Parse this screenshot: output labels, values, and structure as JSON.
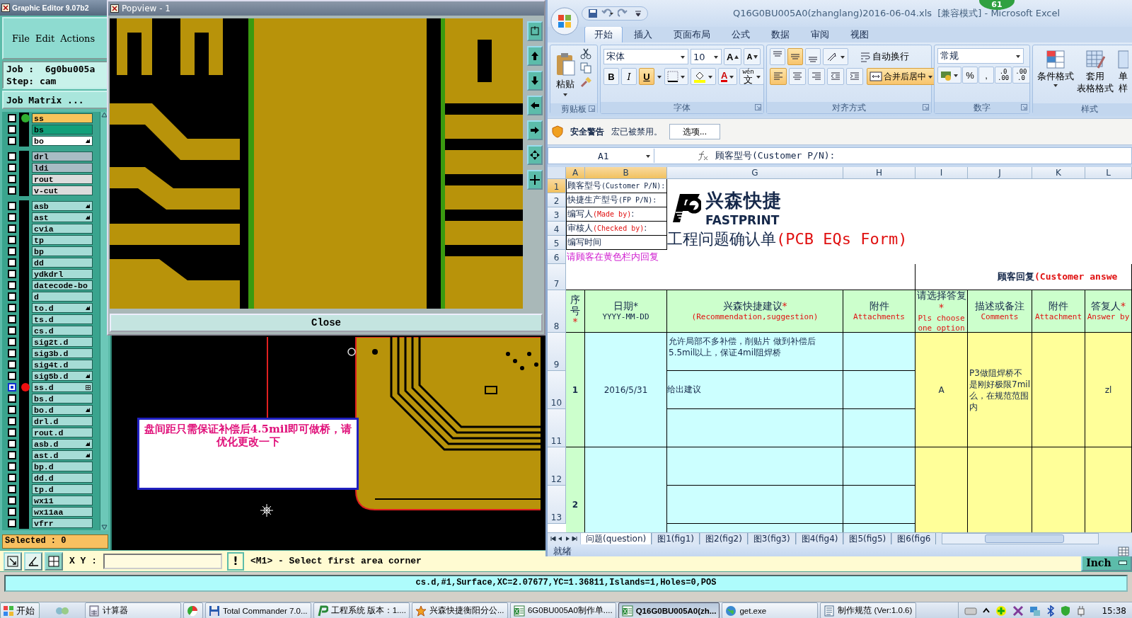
{
  "cam": {
    "title": "Graphic Editor 9.07b2",
    "menu": [
      "File",
      "Edit",
      "Actions"
    ],
    "job": "Job :  6g0bu005a",
    "step": "Step: cam",
    "matrix_button": "Job Matrix ...",
    "layer_groups": [
      {
        "layers": [
          {
            "name": "ss",
            "color": "#f8c45a",
            "dot": {
              "color": "#30b030"
            },
            "kind": "plain",
            "selected": false
          },
          {
            "name": "bs",
            "color": "#12a07a",
            "kind": "plain",
            "selected": false
          },
          {
            "name": "bo",
            "color": "#ffffff",
            "kind": "linked",
            "selected": false
          }
        ]
      },
      {
        "layers": [
          {
            "name": "drl",
            "color": "#a8bcc4",
            "kind": "plain",
            "selected": false
          },
          {
            "name": "ldi",
            "color": "#a8bcc4",
            "kind": "plain",
            "selected": false
          },
          {
            "name": "rout",
            "color": "#dcdcdc",
            "kind": "plain",
            "selected": false
          },
          {
            "name": "v-cut",
            "color": "#dcdcdc",
            "kind": "plain",
            "selected": false
          }
        ]
      },
      {
        "layers": [
          {
            "name": "asb",
            "color": "#a6dcd6",
            "kind": "linked",
            "selected": false
          },
          {
            "name": "ast",
            "color": "#a6dcd6",
            "kind": "linked",
            "selected": false
          },
          {
            "name": "cvia",
            "color": "#a6dcd6",
            "kind": "plain",
            "selected": false
          },
          {
            "name": "tp",
            "color": "#a6dcd6",
            "kind": "plain",
            "selected": false
          },
          {
            "name": "bp",
            "color": "#a6dcd6",
            "kind": "plain",
            "selected": false
          },
          {
            "name": "dd",
            "color": "#a6dcd6",
            "kind": "plain",
            "selected": false
          },
          {
            "name": "ydkdrl",
            "color": "#a6dcd6",
            "kind": "plain",
            "selected": false
          },
          {
            "name": "datecode-bo",
            "color": "#a6dcd6",
            "kind": "plain",
            "selected": false
          },
          {
            "name": "d",
            "color": "#a6dcd6",
            "kind": "plain",
            "selected": false
          },
          {
            "name": "to.d",
            "color": "#a6dcd6",
            "kind": "linked",
            "selected": false
          },
          {
            "name": "ts.d",
            "color": "#a6dcd6",
            "kind": "plain",
            "selected": false
          },
          {
            "name": "cs.d",
            "color": "#a6dcd6",
            "kind": "plain",
            "selected": false
          },
          {
            "name": "sig2t.d",
            "color": "#a6dcd6",
            "kind": "plain",
            "selected": false
          },
          {
            "name": "sig3b.d",
            "color": "#a6dcd6",
            "kind": "plain",
            "selected": false
          },
          {
            "name": "sig4t.d",
            "color": "#a6dcd6",
            "kind": "plain",
            "selected": false
          },
          {
            "name": "sig5b.d",
            "color": "#a6dcd6",
            "kind": "linked",
            "selected": false
          },
          {
            "name": "ss.d",
            "color": "#a6dcd6",
            "dot": {
              "color": "#ee1010"
            },
            "kind": "boxed",
            "selected": true
          },
          {
            "name": "bs.d",
            "color": "#a6dcd6",
            "kind": "plain",
            "selected": false
          },
          {
            "name": "bo.d",
            "color": "#a6dcd6",
            "kind": "linked",
            "selected": false
          },
          {
            "name": "drl.d",
            "color": "#a6dcd6",
            "kind": "plain",
            "selected": false
          },
          {
            "name": "rout.d",
            "color": "#a6dcd6",
            "kind": "plain",
            "selected": false
          },
          {
            "name": "asb.d",
            "color": "#a6dcd6",
            "kind": "linked",
            "selected": false
          },
          {
            "name": "ast.d",
            "color": "#a6dcd6",
            "kind": "linked",
            "selected": false
          },
          {
            "name": "bp.d",
            "color": "#a6dcd6",
            "kind": "plain",
            "selected": false
          },
          {
            "name": "dd.d",
            "color": "#a6dcd6",
            "kind": "plain",
            "selected": false
          },
          {
            "name": "tp.d",
            "color": "#a6dcd6",
            "kind": "plain",
            "selected": false
          },
          {
            "name": "wx11",
            "color": "#a6dcd6",
            "kind": "plain",
            "selected": false
          },
          {
            "name": "wx11aa",
            "color": "#a6dcd6",
            "kind": "plain",
            "selected": false
          },
          {
            "name": "vfrr",
            "color": "#a6dcd6",
            "kind": "plain",
            "selected": false
          }
        ]
      }
    ],
    "selected_count": "Selected : 0",
    "annotation": "盘间距只需保证补偿后4.5mil即可做桥，请优化更改一下",
    "command_bar": {
      "xy_label": "X Y :",
      "alert": "!",
      "message": "<M1> - Select first area corner",
      "unit": "Inch"
    },
    "status_line": "cs.d,#1,Surface,XC=2.07677,YC=1.36811,Islands=1,Holes=0,POS"
  },
  "popview": {
    "title": "Popview - 1",
    "close": "Close"
  },
  "excel": {
    "title": "Q16G0BU005A0(zhanglang)2016-06-04.xls  [兼容模式] - Microsoft Excel",
    "badge": "61",
    "tabs": [
      {
        "label": "开始",
        "selected": true
      },
      {
        "label": "插入",
        "selected": false
      },
      {
        "label": "页面布局",
        "selected": false
      },
      {
        "label": "公式",
        "selected": false
      },
      {
        "label": "数据",
        "selected": false
      },
      {
        "label": "审阅",
        "selected": false
      },
      {
        "label": "视图",
        "selected": false
      }
    ],
    "clipboard": {
      "paste": "粘贴",
      "label": "剪贴板"
    },
    "font": {
      "name": "宋体",
      "size": "10",
      "grow": "A",
      "shrink": "A",
      "styles": [
        {
          "label": "B",
          "on": false
        },
        {
          "label": "I",
          "on": false
        },
        {
          "label": "U",
          "on": true
        }
      ],
      "color_letter": "A",
      "phonetic": {
        "ruby": "wén",
        "label": "文"
      },
      "label": "字体"
    },
    "alignment": {
      "vertical": [
        {
          "on": false
        },
        {
          "on": true
        },
        {
          "on": false
        }
      ],
      "wrap": "自动换行",
      "horizontal": [
        {
          "on": true
        },
        {
          "on": false
        },
        {
          "on": false
        }
      ],
      "merge": {
        "label": "合并后居中",
        "on": true
      },
      "label": "对齐方式"
    },
    "number": {
      "format": "常规",
      "percent": "%",
      "comma": ",",
      "increase_decimal": [
        ".0",
        ".00"
      ],
      "decrease_decimal": [
        ".00",
        ".0"
      ],
      "label": "数字"
    },
    "styles": {
      "conditional": "条件格式",
      "table": [
        "套用",
        "表格格式"
      ],
      "cell": [
        "单",
        "样"
      ],
      "label": "样式"
    },
    "security": {
      "title": "安全警告",
      "message": "宏已被禁用。",
      "button": "选项..."
    },
    "name_box": "A1",
    "formula": "顾客型号(Customer P/N):",
    "columns": [
      {
        "label": "A",
        "selected": true
      },
      {
        "label": "B",
        "selected": true
      },
      {
        "label": "G",
        "selected": false
      },
      {
        "label": "H",
        "selected": false
      },
      {
        "label": "I",
        "selected": false
      },
      {
        "label": "J",
        "selected": false
      },
      {
        "label": "K",
        "selected": false
      },
      {
        "label": "L",
        "selected": false
      }
    ],
    "rows": [
      {
        "label": "1",
        "selected": true
      },
      {
        "label": "2",
        "selected": false
      },
      {
        "label": "3",
        "selected": false
      },
      {
        "label": "4",
        "selected": false
      },
      {
        "label": "5",
        "selected": false
      },
      {
        "label": "6",
        "selected": false
      },
      {
        "label": "7",
        "selected": false
      },
      {
        "label": "8",
        "selected": false
      },
      {
        "label": "9",
        "selected": false
      },
      {
        "label": "10",
        "selected": false
      },
      {
        "label": "11",
        "selected": false
      },
      {
        "label": "12",
        "selected": false
      },
      {
        "label": "13",
        "selected": false
      }
    ],
    "info": [
      {
        "text": "顾客型号",
        "note": "(Customer P/N):",
        "kind": "label"
      },
      {
        "text": "快捷生产型号",
        "note": "(FP P/N):",
        "kind": "label"
      },
      {
        "text": "编写人",
        "note": "(Made by)",
        "tail": ":",
        "kind": "signed"
      },
      {
        "text": "审核人",
        "note": "(Checked by)",
        "tail": ":",
        "kind": "signed"
      },
      {
        "text": "编写时间",
        "kind": "label"
      },
      {
        "text": "请顾客在黄色栏内回复",
        "kind": "notice"
      }
    ],
    "logo": {
      "name": "兴森快捷",
      "subtitle": "FASTPRINT"
    },
    "form_title": {
      "text": "工程问题确认单",
      "note": "(PCB EQs Form)"
    },
    "reply_header": {
      "text": "顾客回复",
      "note": "(Customer answe"
    },
    "headers": [
      {
        "title": "序号",
        "mark": "*"
      },
      {
        "title": "日期*",
        "subtitle": "YYYY-MM-DD",
        "kind": "hint"
      },
      {
        "title": "兴森快捷建议",
        "mark": "*",
        "subtitle": "(Recommendation,suggestion)",
        "kind": "translation"
      },
      {
        "title": "附件",
        "subtitle": "Attachments",
        "kind": "translation"
      },
      {
        "title": "请选择答复",
        "mark": "*",
        "subtitle": "Pls choose one option",
        "kind": "translation"
      },
      {
        "title": "描述或备注",
        "subtitle": "Comments",
        "kind": "translation"
      },
      {
        "title": "附件",
        "subtitle": "Attachment",
        "kind": "translation"
      },
      {
        "title": "答复人",
        "mark": "*",
        "subtitle": "Answer by",
        "kind": "translation"
      }
    ],
    "entries": [
      {
        "number": "1",
        "date": "2016/5/31",
        "suggestions": [
          "允许局部不多补偿，削贴片 做到补偿后5.5mil以上，保证4mil阻焊桥",
          "给出建议"
        ],
        "option": "A",
        "comment": "P3做阻焊桥不是刚好极限7mil么，在规范范围内",
        "answered_by": "zl"
      },
      {
        "number": "2"
      }
    ],
    "sheets": [
      {
        "label": "问题(question)",
        "selected": true
      },
      {
        "label": "图1(fig1)",
        "selected": false
      },
      {
        "label": "图2(fig2)",
        "selected": false
      },
      {
        "label": "图3(fig3)",
        "selected": false
      },
      {
        "label": "图4(fig4)",
        "selected": false
      },
      {
        "label": "图5(fig5)",
        "selected": false
      },
      {
        "label": "图6(fig6",
        "selected": false
      }
    ],
    "status": "就绪"
  },
  "taskbar": {
    "start": "开始",
    "tasks": [
      {
        "label": "计算器",
        "kind": "calculator",
        "selected": false
      },
      {
        "kind": "pie",
        "selected": false
      },
      {
        "label": "Total Commander 7.0...",
        "kind": "disk",
        "selected": false
      },
      {
        "label": "工程系统  版本：1....",
        "kind": "app",
        "selected": false
      },
      {
        "label": "兴森快捷衡阳分公...",
        "kind": "star",
        "selected": false
      },
      {
        "label": "6G0BU005A0制作单....",
        "kind": "sheet",
        "selected": false
      },
      {
        "label": "Q16G0BU005A0(zh...",
        "kind": "sheet",
        "selected": true
      },
      {
        "label": "get.exe",
        "kind": "globe",
        "selected": false
      },
      {
        "label": "制作规范 (Ver:1.0.6)",
        "kind": "doc",
        "selected": false
      }
    ],
    "clock": "15:38"
  }
}
